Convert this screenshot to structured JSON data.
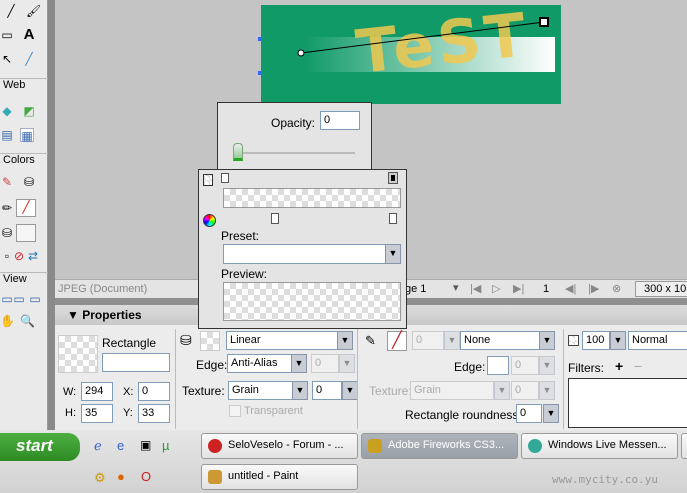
{
  "tools": {
    "web_label": "Web",
    "colors_label": "Colors",
    "view_label": "View"
  },
  "canvas": {
    "text": "TeST"
  },
  "status": {
    "doc_label": "JPEG (Document)",
    "page": "ge 1",
    "frame": "1",
    "size": "300 x 10"
  },
  "opacity_popup": {
    "label": "Opacity:",
    "value": "0",
    "slider_value": 0
  },
  "gradient_popup": {
    "preset_label": "Preset:",
    "preview_label": "Preview:",
    "preset_value": ""
  },
  "properties": {
    "title": "Properties",
    "object_type": "Rectangle",
    "name_value": "",
    "w_label": "W:",
    "w": "294",
    "h_label": "H:",
    "h": "35",
    "x_label": "X:",
    "x": "0",
    "y_label": "Y:",
    "y": "33",
    "fill_type": "Linear",
    "edge_label": "Edge:",
    "edge": "Anti-Alias",
    "edge_amount": "0",
    "texture_label": "Texture:",
    "texture": "Grain",
    "texture_amount": "0",
    "transparent_label": "Transparent",
    "stroke_size": "0",
    "stroke_type": "None",
    "stroke_edge_label": "Edge:",
    "stroke_edge_amount": "0",
    "stroke_texture_label": "Texture:",
    "stroke_texture": "Grain",
    "stroke_texture_amount": "0",
    "roundness_label": "Rectangle roundness:",
    "roundness": "0",
    "opacity": "100",
    "blend": "Normal",
    "filters_label": "Filters:"
  },
  "taskbar": {
    "start": "start",
    "tasks": [
      "SeloVeselo - Forum - ...",
      "Adobe Fireworks CS3...",
      "Windows Live Messen...",
      "untitled - Paint"
    ],
    "watermark": "www.mycity.co.yu"
  }
}
